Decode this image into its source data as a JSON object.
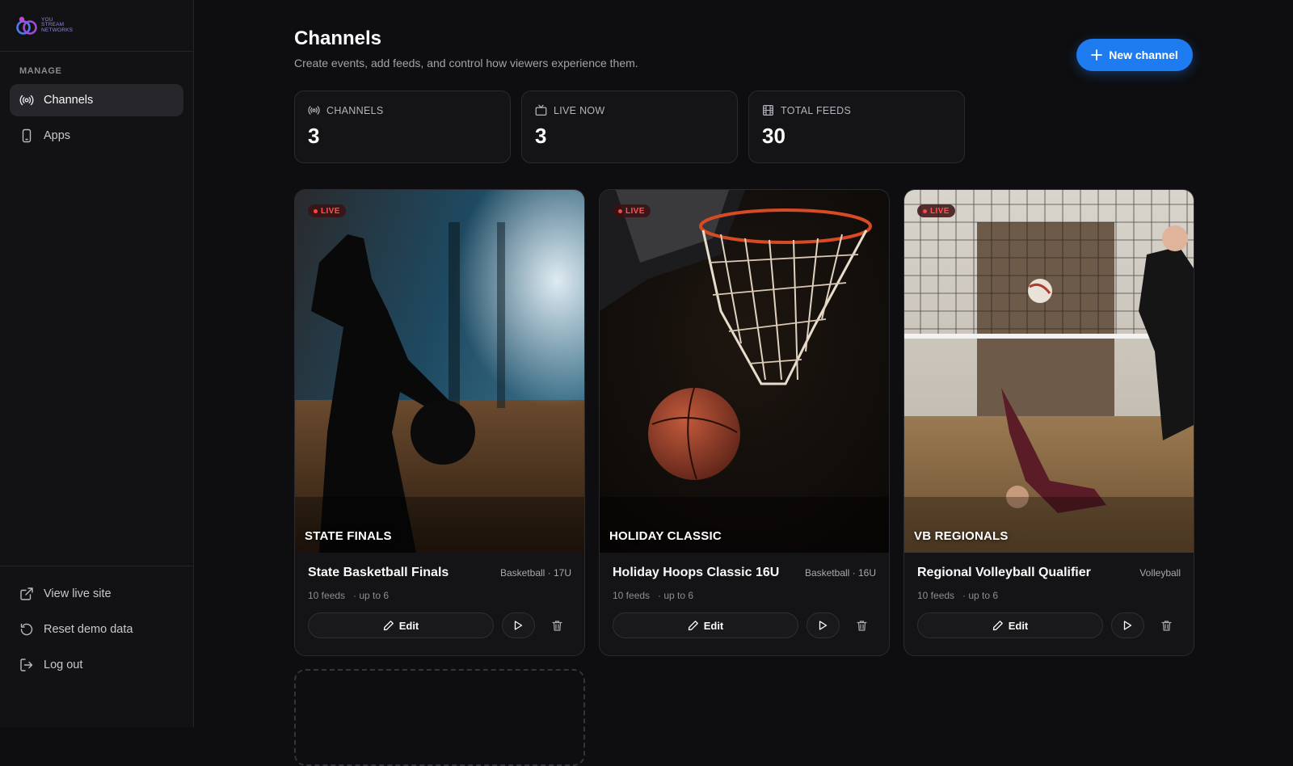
{
  "brand": {
    "logo_text": "YOU STREAM NETWORKS"
  },
  "sidebar": {
    "section_label": "MANAGE",
    "items": [
      {
        "label": "Channels",
        "icon": "broadcast-icon",
        "active": true
      },
      {
        "label": "Apps",
        "icon": "phone-icon",
        "active": false
      }
    ],
    "bottom_items": [
      {
        "label": "View live site",
        "icon": "external-link-icon"
      },
      {
        "label": "Reset demo data",
        "icon": "reset-icon"
      },
      {
        "label": "Log out",
        "icon": "logout-icon"
      }
    ]
  },
  "header": {
    "title": "Channels",
    "subtitle": "Create events, add feeds, and control how viewers experience them.",
    "new_button_label": "New channel"
  },
  "stats": [
    {
      "label": "CHANNELS",
      "value": "3",
      "icon": "broadcast-icon"
    },
    {
      "label": "LIVE NOW",
      "value": "3",
      "icon": "tv-icon"
    },
    {
      "label": "TOTAL FEEDS",
      "value": "30",
      "icon": "film-icon"
    }
  ],
  "channels": [
    {
      "badge": "LIVE",
      "thumb_title": "STATE FINALS",
      "name": "State Basketball Finals",
      "tag": "Basketball · 17U",
      "feeds": "10 feeds",
      "limit": "· up to 6",
      "edit_label": "Edit"
    },
    {
      "badge": "LIVE",
      "thumb_title": "HOLIDAY CLASSIC",
      "name": "Holiday Hoops Classic 16U",
      "tag": "Basketball · 16U",
      "feeds": "10 feeds",
      "limit": "· up to 6",
      "edit_label": "Edit"
    },
    {
      "badge": "LIVE",
      "thumb_title": "VB REGIONALS",
      "name": "Regional Volleyball Qualifier",
      "tag": "Volleyball",
      "feeds": "10 feeds",
      "limit": "· up to 6",
      "edit_label": "Edit"
    }
  ],
  "colors": {
    "accent": "#1e7cf0",
    "live": "#ff4444",
    "background": "#0e0e10"
  }
}
